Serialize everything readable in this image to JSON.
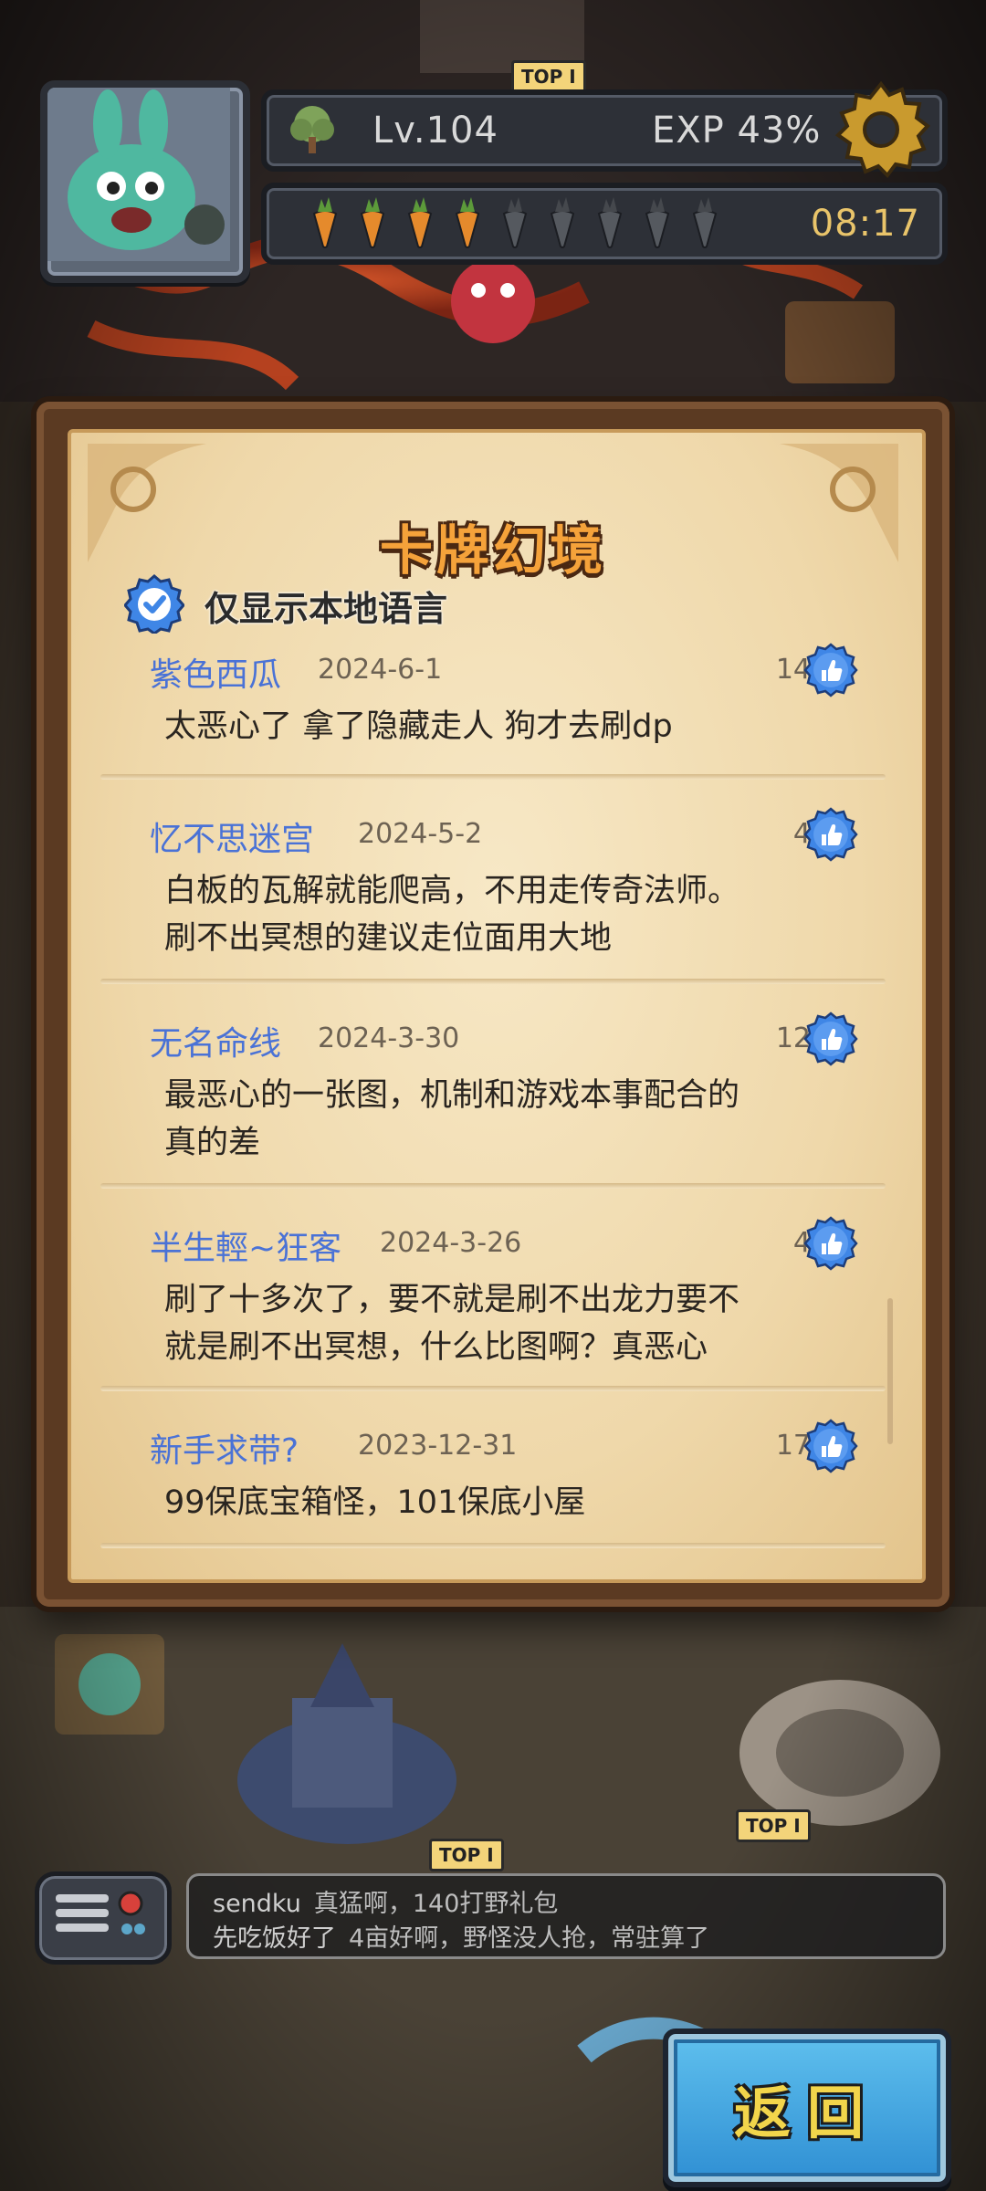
{
  "hud": {
    "level": "Lv.104",
    "exp": "EXP 43%",
    "timer": "08:17",
    "stamina": {
      "filled": 4,
      "total": 9
    }
  },
  "map_badges": [
    "TOP I",
    "TOP I",
    "TOP I"
  ],
  "panel": {
    "title": "卡牌幻境",
    "filter_label": "仅显示本地语言",
    "filter_checked": true
  },
  "comments": [
    {
      "user": "紫色西瓜",
      "date": "2024-6-1",
      "likes": "14",
      "text": "太恶心了 拿了隐藏走人 狗才去刷dp"
    },
    {
      "user": "忆不思迷宫",
      "date": "2024-5-2",
      "likes": "4",
      "text": "白板的瓦解就能爬高，不用走传奇法师。\n刷不出冥想的建议走位面用大地"
    },
    {
      "user": "无名命线",
      "date": "2024-3-30",
      "likes": "12",
      "text": "最恶心的一张图，机制和游戏本事配合的\n真的差"
    },
    {
      "user": "半生輕~狂客",
      "date": "2024-3-26",
      "likes": "4",
      "text": "刷了十多次了，要不就是刷不出龙力要不\n就是刷不出冥想，什么比图啊？真恶心"
    },
    {
      "user": "新手求带?",
      "date": "2023-12-31",
      "likes": "17",
      "text": "99保底宝箱怪，101保底小屋"
    }
  ],
  "chat": [
    {
      "name": "sendku",
      "message": "真猛啊，140打野礼包"
    },
    {
      "name": "先吃饭好了",
      "message": "4亩好啊，野怪没人抢，常驻算了"
    }
  ],
  "back_button": "返回",
  "colors": {
    "accent_title": "#f5a23a",
    "username": "#4a72d6",
    "back_button": "#3fa5e0"
  }
}
